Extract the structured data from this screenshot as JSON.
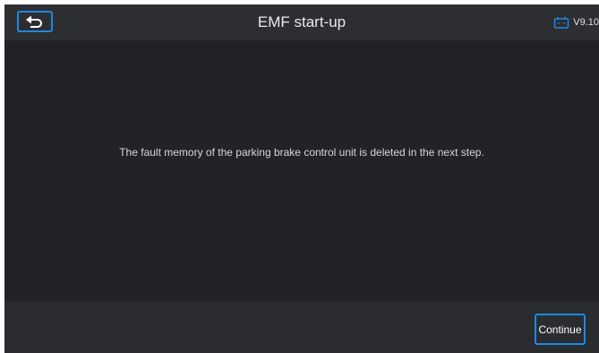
{
  "header": {
    "back_icon": "return-arrow-icon",
    "title": "EMF start-up",
    "battery_icon": "battery-icon",
    "version": "V9.10"
  },
  "main": {
    "message": "The fault memory of the parking brake control unit is deleted in the next step."
  },
  "footer": {
    "continue_label": "Continue"
  },
  "colors": {
    "accent": "#1e88e5",
    "background": "#212326",
    "header_background": "#2c2e32",
    "footer_background": "#2a2c30",
    "text": "#d6d8db"
  }
}
